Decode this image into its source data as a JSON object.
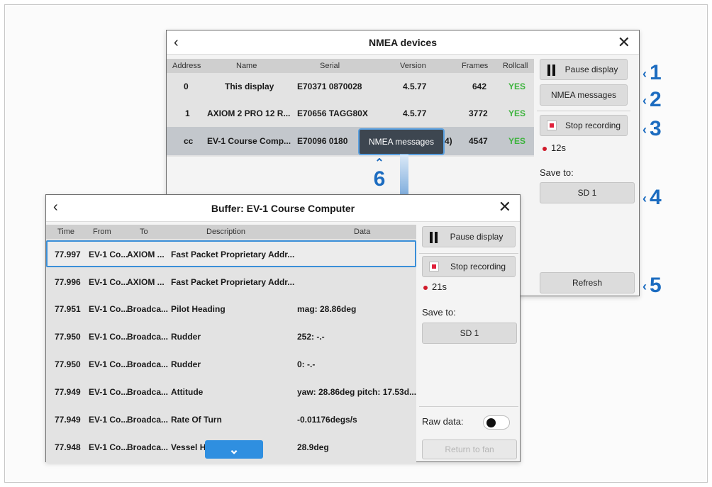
{
  "nmea_window": {
    "title": "NMEA devices",
    "back_icon": "‹",
    "close_icon": "✕",
    "columns": [
      "Address",
      "Name",
      "Serial",
      "Version",
      "Frames",
      "Rollcall"
    ],
    "rows": [
      {
        "address": "0",
        "name": "This display",
        "serial": "E70371 0870028",
        "version": "4.5.77",
        "frames": "642",
        "rollcall": "YES"
      },
      {
        "address": "1",
        "name": "AXIOM 2 PRO 12 R...",
        "serial": "E70656 TAGG80X",
        "version": "4.5.77",
        "frames": "3772",
        "rollcall": "YES"
      },
      {
        "address": "cc",
        "name": "EV-1 Course Comp...",
        "serial": "E70096 0180",
        "version": "4)",
        "frames": "4547",
        "rollcall": "YES"
      }
    ],
    "sidebar": {
      "pause": "Pause display",
      "nmea_messages": "NMEA messages",
      "stop_recording": "Stop recording",
      "timer": "12s",
      "save_to_label": "Save to:",
      "save_to_value": "SD 1",
      "refresh": "Refresh"
    },
    "tooltip": "NMEA messages"
  },
  "buffer_window": {
    "title": "Buffer: EV-1 Course Computer",
    "back_icon": "‹",
    "close_icon": "✕",
    "columns": [
      "Time",
      "From",
      "To",
      "Description",
      "Data"
    ],
    "rows": [
      {
        "time": "77.997",
        "from": "EV-1 Co...",
        "to": "AXIOM ...",
        "desc": "Fast Packet Proprietary Addr...",
        "data": ""
      },
      {
        "time": "77.996",
        "from": "EV-1 Co...",
        "to": "AXIOM ...",
        "desc": "Fast Packet Proprietary Addr...",
        "data": ""
      },
      {
        "time": "77.951",
        "from": "EV-1 Co...",
        "to": "Broadca...",
        "desc": "Pilot Heading",
        "data": "mag: 28.86deg"
      },
      {
        "time": "77.950",
        "from": "EV-1 Co...",
        "to": "Broadca...",
        "desc": "Rudder",
        "data": "252: -.-"
      },
      {
        "time": "77.950",
        "from": "EV-1 Co...",
        "to": "Broadca...",
        "desc": "Rudder",
        "data": "0: -.-"
      },
      {
        "time": "77.949",
        "from": "EV-1 Co...",
        "to": "Broadca...",
        "desc": "Attitude",
        "data": "yaw: 28.86deg pitch: 17.53d..."
      },
      {
        "time": "77.949",
        "from": "EV-1 Co...",
        "to": "Broadca...",
        "desc": "Rate Of Turn",
        "data": "-0.01176degs/s"
      },
      {
        "time": "77.948",
        "from": "EV-1 Co...",
        "to": "Broadca...",
        "desc": "Vessel H",
        "data": "28.9deg"
      }
    ],
    "sidebar": {
      "pause": "Pause display",
      "stop_recording": "Stop recording",
      "timer": "21s",
      "save_to_label": "Save to:",
      "save_to_value": "SD 1",
      "raw_data_label": "Raw data:",
      "return_button": "Return to fan"
    },
    "scroll_down_icon": "⌄"
  },
  "callouts": {
    "c1": "1",
    "c2": "2",
    "c3": "3",
    "c4": "4",
    "c5": "5",
    "c6": "6",
    "chevron": "‹",
    "color": "#1c6cc0"
  }
}
